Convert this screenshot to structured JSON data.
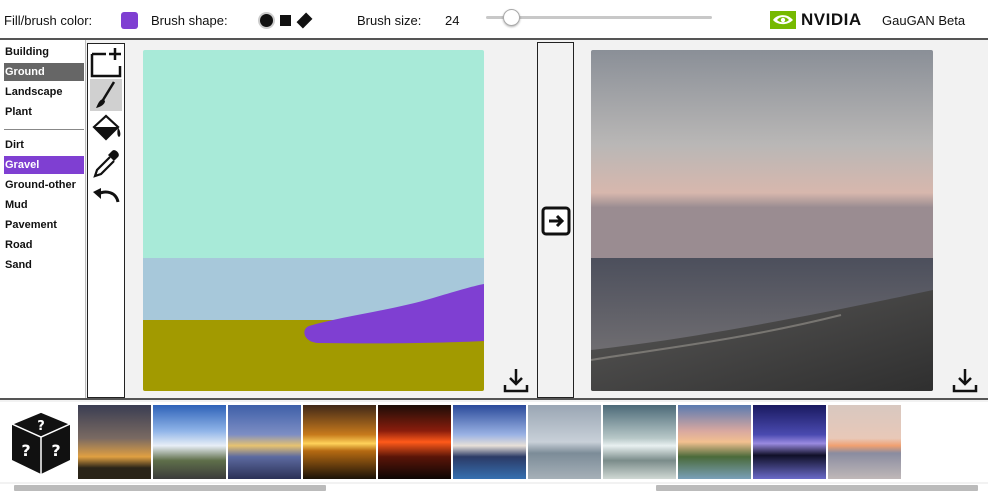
{
  "toolbar": {
    "color_label": "Fill/brush color:",
    "selected_color": "#7f3fd2",
    "shape_label": "Brush shape:",
    "shapes": [
      "circle",
      "square",
      "diamond"
    ],
    "size_label": "Brush size:",
    "size_value": "24",
    "size_slider_fraction": 0.11,
    "brand": "NVIDIA",
    "app_name": "GauGAN Beta"
  },
  "labels": {
    "categories": [
      "Building",
      "Ground",
      "Landscape",
      "Plant"
    ],
    "selected_category": "Ground",
    "subcategories": [
      "Dirt",
      "Gravel",
      "Ground-other",
      "Mud",
      "Pavement",
      "Road",
      "Sand"
    ],
    "selected_subcategory": "Gravel"
  },
  "tools": [
    "new-canvas-icon",
    "brush-icon",
    "paint-bucket-icon",
    "eyedropper-icon",
    "undo-icon"
  ],
  "active_tool": "brush-icon",
  "canvas_colors": {
    "sky": "#a8ead8",
    "sea": "#a7c8da",
    "ground": "#a29a00",
    "gravel": "#7f3fd2"
  },
  "icons": {
    "download": "download-icon",
    "generate": "arrow-right-icon",
    "random": "random-dice-icon",
    "logo": "nvidia-eye-icon"
  },
  "style_thumbnails": [
    "sunset-tree",
    "blue-sky-road",
    "sunset-horizon",
    "golden-sunset",
    "red-fire-sky",
    "coastal-cliff",
    "grey-seashore",
    "misty-lake",
    "pink-clouds",
    "purple-dusk-lake",
    "calm-sunset-sea"
  ]
}
